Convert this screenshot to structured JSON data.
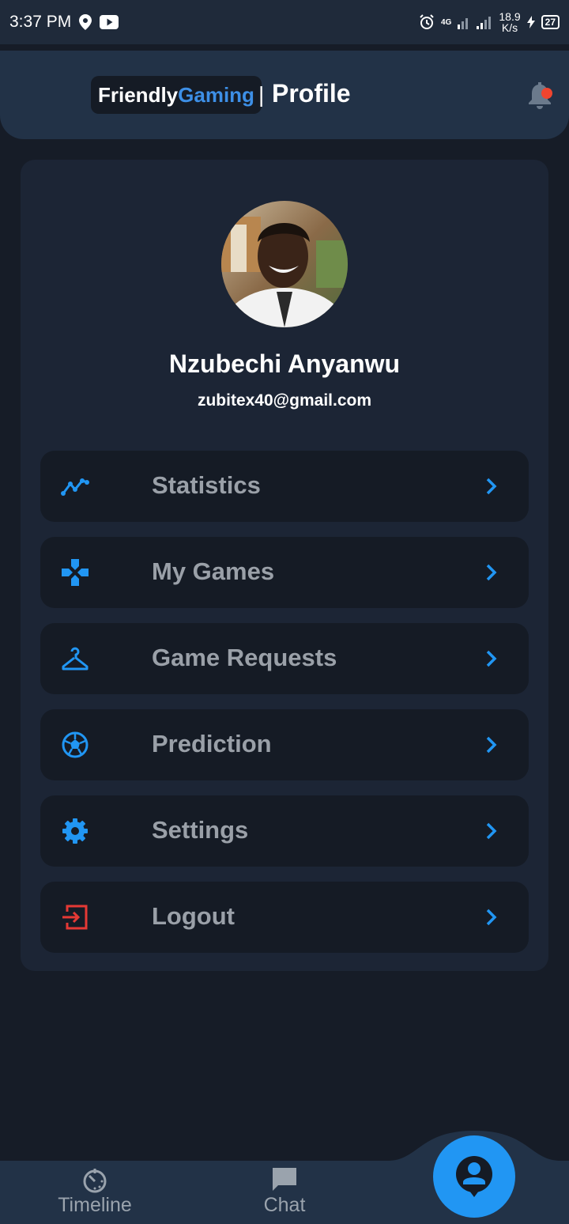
{
  "status_bar": {
    "time": "3:37 PM",
    "network": "4G",
    "speed_value": "18.9",
    "speed_unit": "K/s",
    "battery": "27",
    "icons": [
      "location-icon",
      "youtube-icon",
      "alarm-icon",
      "signal-icon",
      "charging-icon"
    ]
  },
  "header": {
    "brand_part1": "Friendly",
    "brand_part2": "Gaming",
    "separator": "|",
    "title": "Profile",
    "notification_icon": "bell-icon",
    "notification_dot_color": "#f0452f"
  },
  "profile": {
    "name": "Nzubechi Anyanwu",
    "email": "zubitex40@gmail.com"
  },
  "menu": [
    {
      "label": "Statistics",
      "icon": "chart-line-icon"
    },
    {
      "label": "My Games",
      "icon": "gamepad-icon"
    },
    {
      "label": "Game Requests",
      "icon": "hanger-icon"
    },
    {
      "label": "Prediction",
      "icon": "soccer-ball-icon"
    },
    {
      "label": "Settings",
      "icon": "gear-icon"
    },
    {
      "label": "Logout",
      "icon": "logout-icon"
    }
  ],
  "bottom_nav": {
    "items": [
      {
        "label": "Timeline",
        "icon": "timer-icon"
      },
      {
        "label": "Chat",
        "icon": "chat-icon"
      }
    ],
    "fab_icon": "profile-icon"
  },
  "colors": {
    "accent": "#2196f3",
    "brand_blue": "#3d8fe6",
    "logout_red": "#e53935",
    "background": "#161c27",
    "card": "#1c2535",
    "header": "#223247"
  }
}
